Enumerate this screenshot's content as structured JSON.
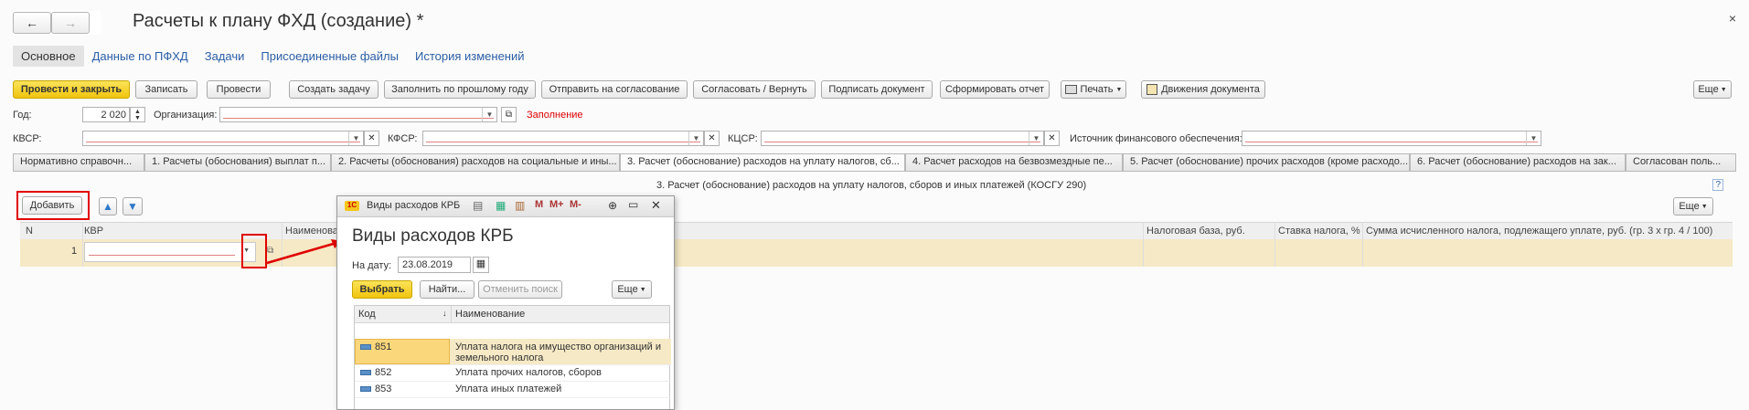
{
  "window": {
    "title": "Расчеты к плану ФХД (создание) *",
    "close_glyph": "×"
  },
  "nav": {
    "back_glyph": "←",
    "forward_glyph": "→"
  },
  "form_tabs": [
    {
      "label": "Основное"
    },
    {
      "label": "Данные по ПФХД"
    },
    {
      "label": "Задачи"
    },
    {
      "label": "Присоединенные файлы"
    },
    {
      "label": "История изменений"
    }
  ],
  "toolbar": {
    "post_close": "Провести и закрыть",
    "write": "Записать",
    "post": "Провести",
    "create_task": "Создать задачу",
    "fill_prev_year": "Заполнить по прошлому году",
    "send_approval": "Отправить на согласование",
    "approve_return": "Согласовать / Вернуть",
    "sign": "Подписать документ",
    "report": "Сформировать отчет",
    "print": "Печать",
    "movements": "Движения документа",
    "more": "Еще"
  },
  "fields": {
    "year_label": "Год:",
    "year_value": "2 020",
    "org_label": "Организация:",
    "fill_link": "Заполнение",
    "kvsr_label": "КВСР:",
    "kfsr_label": "КФСР:",
    "kcsr_label": "КЦСР:",
    "source_label": "Источник финансового обеспечения:"
  },
  "doc_tabs": [
    {
      "label": "Нормативно справочн..."
    },
    {
      "label": "1. Расчеты (обоснования) выплат п..."
    },
    {
      "label": "2. Расчеты (обоснования) расходов на социальные и ины..."
    },
    {
      "label": "3. Расчет (обоснование) расходов на уплату налогов, сб..."
    },
    {
      "label": "4. Расчет расходов на безвозмездные пе..."
    },
    {
      "label": "5. Расчет (обоснование) прочих расходов (кроме расходо..."
    },
    {
      "label": "6. Расчет (обоснование) расходов на зак..."
    },
    {
      "label": "Согласован поль..."
    }
  ],
  "section": {
    "caption": "3. Расчет (обоснование) расходов на уплату налогов, сборов и иных платежей (КОСГУ 290)",
    "help_glyph": "?",
    "add_button": "Добавить",
    "more": "Еще"
  },
  "grid": {
    "columns": {
      "n": "N",
      "kvr": "КВР",
      "name": "Наименова",
      "tax_base": "Налоговая база, руб.",
      "rate": "Ставка налога, %",
      "sum": "Сумма исчисленного налога, подлежащего уплате, руб. (гр. 3 x гр. 4 / 100)"
    },
    "rows": [
      {
        "n": "1"
      }
    ]
  },
  "popup": {
    "window_title": "Виды расходов КРБ",
    "heading": "Виды расходов КРБ",
    "date_label": "На дату:",
    "date_value": "23.08.2019",
    "select_button": "Выбрать",
    "find_button": "Найти...",
    "cancel_search_button": "Отменить поиск",
    "more": "Еще",
    "columns": {
      "code": "Код",
      "name": "Наименование"
    },
    "rows": [
      {
        "code": "851",
        "name": "Уплата налога на имущество организаций и земельного налога"
      },
      {
        "code": "852",
        "name": "Уплата прочих налогов, сборов"
      },
      {
        "code": "853",
        "name": "Уплата иных платежей"
      }
    ],
    "icons": {
      "m": "M",
      "mplus": "M+",
      "mminus": "M-"
    }
  },
  "colors": {
    "accent_yellow": "#f1c50e",
    "link_blue": "#2b5ea5",
    "highlight_red": "#e00000",
    "row_selected": "#f6e9c5"
  }
}
